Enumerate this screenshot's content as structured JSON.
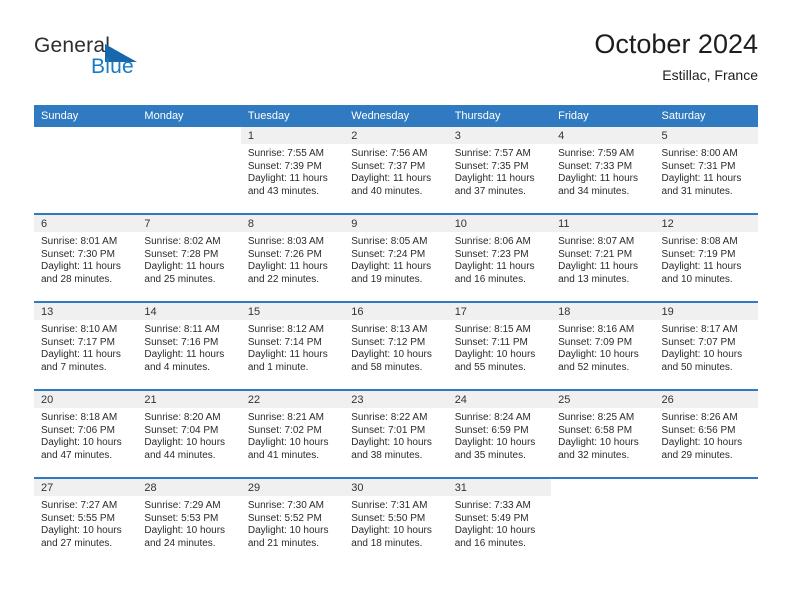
{
  "brand": {
    "name_part1": "General",
    "name_part2": "Blue",
    "triangle_color": "#1668ab",
    "blue_color": "#1a7bc4"
  },
  "header": {
    "title": "October 2024",
    "subtitle": "Estillac, France",
    "accent_color": "#2f7ac0"
  },
  "weekday_headers": [
    "Sunday",
    "Monday",
    "Tuesday",
    "Wednesday",
    "Thursday",
    "Friday",
    "Saturday"
  ],
  "weeks": [
    [
      {
        "day": "",
        "sunrise": "",
        "sunset": "",
        "daylight1": "",
        "daylight2": "",
        "blank": true
      },
      {
        "day": "",
        "sunrise": "",
        "sunset": "",
        "daylight1": "",
        "daylight2": "",
        "blank": true
      },
      {
        "day": "1",
        "sunrise": "Sunrise: 7:55 AM",
        "sunset": "Sunset: 7:39 PM",
        "daylight1": "Daylight: 11 hours",
        "daylight2": "and 43 minutes."
      },
      {
        "day": "2",
        "sunrise": "Sunrise: 7:56 AM",
        "sunset": "Sunset: 7:37 PM",
        "daylight1": "Daylight: 11 hours",
        "daylight2": "and 40 minutes."
      },
      {
        "day": "3",
        "sunrise": "Sunrise: 7:57 AM",
        "sunset": "Sunset: 7:35 PM",
        "daylight1": "Daylight: 11 hours",
        "daylight2": "and 37 minutes."
      },
      {
        "day": "4",
        "sunrise": "Sunrise: 7:59 AM",
        "sunset": "Sunset: 7:33 PM",
        "daylight1": "Daylight: 11 hours",
        "daylight2": "and 34 minutes."
      },
      {
        "day": "5",
        "sunrise": "Sunrise: 8:00 AM",
        "sunset": "Sunset: 7:31 PM",
        "daylight1": "Daylight: 11 hours",
        "daylight2": "and 31 minutes."
      }
    ],
    [
      {
        "day": "6",
        "sunrise": "Sunrise: 8:01 AM",
        "sunset": "Sunset: 7:30 PM",
        "daylight1": "Daylight: 11 hours",
        "daylight2": "and 28 minutes."
      },
      {
        "day": "7",
        "sunrise": "Sunrise: 8:02 AM",
        "sunset": "Sunset: 7:28 PM",
        "daylight1": "Daylight: 11 hours",
        "daylight2": "and 25 minutes."
      },
      {
        "day": "8",
        "sunrise": "Sunrise: 8:03 AM",
        "sunset": "Sunset: 7:26 PM",
        "daylight1": "Daylight: 11 hours",
        "daylight2": "and 22 minutes."
      },
      {
        "day": "9",
        "sunrise": "Sunrise: 8:05 AM",
        "sunset": "Sunset: 7:24 PM",
        "daylight1": "Daylight: 11 hours",
        "daylight2": "and 19 minutes."
      },
      {
        "day": "10",
        "sunrise": "Sunrise: 8:06 AM",
        "sunset": "Sunset: 7:23 PM",
        "daylight1": "Daylight: 11 hours",
        "daylight2": "and 16 minutes."
      },
      {
        "day": "11",
        "sunrise": "Sunrise: 8:07 AM",
        "sunset": "Sunset: 7:21 PM",
        "daylight1": "Daylight: 11 hours",
        "daylight2": "and 13 minutes."
      },
      {
        "day": "12",
        "sunrise": "Sunrise: 8:08 AM",
        "sunset": "Sunset: 7:19 PM",
        "daylight1": "Daylight: 11 hours",
        "daylight2": "and 10 minutes."
      }
    ],
    [
      {
        "day": "13",
        "sunrise": "Sunrise: 8:10 AM",
        "sunset": "Sunset: 7:17 PM",
        "daylight1": "Daylight: 11 hours",
        "daylight2": "and 7 minutes."
      },
      {
        "day": "14",
        "sunrise": "Sunrise: 8:11 AM",
        "sunset": "Sunset: 7:16 PM",
        "daylight1": "Daylight: 11 hours",
        "daylight2": "and 4 minutes."
      },
      {
        "day": "15",
        "sunrise": "Sunrise: 8:12 AM",
        "sunset": "Sunset: 7:14 PM",
        "daylight1": "Daylight: 11 hours",
        "daylight2": "and 1 minute."
      },
      {
        "day": "16",
        "sunrise": "Sunrise: 8:13 AM",
        "sunset": "Sunset: 7:12 PM",
        "daylight1": "Daylight: 10 hours",
        "daylight2": "and 58 minutes."
      },
      {
        "day": "17",
        "sunrise": "Sunrise: 8:15 AM",
        "sunset": "Sunset: 7:11 PM",
        "daylight1": "Daylight: 10 hours",
        "daylight2": "and 55 minutes."
      },
      {
        "day": "18",
        "sunrise": "Sunrise: 8:16 AM",
        "sunset": "Sunset: 7:09 PM",
        "daylight1": "Daylight: 10 hours",
        "daylight2": "and 52 minutes."
      },
      {
        "day": "19",
        "sunrise": "Sunrise: 8:17 AM",
        "sunset": "Sunset: 7:07 PM",
        "daylight1": "Daylight: 10 hours",
        "daylight2": "and 50 minutes."
      }
    ],
    [
      {
        "day": "20",
        "sunrise": "Sunrise: 8:18 AM",
        "sunset": "Sunset: 7:06 PM",
        "daylight1": "Daylight: 10 hours",
        "daylight2": "and 47 minutes."
      },
      {
        "day": "21",
        "sunrise": "Sunrise: 8:20 AM",
        "sunset": "Sunset: 7:04 PM",
        "daylight1": "Daylight: 10 hours",
        "daylight2": "and 44 minutes."
      },
      {
        "day": "22",
        "sunrise": "Sunrise: 8:21 AM",
        "sunset": "Sunset: 7:02 PM",
        "daylight1": "Daylight: 10 hours",
        "daylight2": "and 41 minutes."
      },
      {
        "day": "23",
        "sunrise": "Sunrise: 8:22 AM",
        "sunset": "Sunset: 7:01 PM",
        "daylight1": "Daylight: 10 hours",
        "daylight2": "and 38 minutes."
      },
      {
        "day": "24",
        "sunrise": "Sunrise: 8:24 AM",
        "sunset": "Sunset: 6:59 PM",
        "daylight1": "Daylight: 10 hours",
        "daylight2": "and 35 minutes."
      },
      {
        "day": "25",
        "sunrise": "Sunrise: 8:25 AM",
        "sunset": "Sunset: 6:58 PM",
        "daylight1": "Daylight: 10 hours",
        "daylight2": "and 32 minutes."
      },
      {
        "day": "26",
        "sunrise": "Sunrise: 8:26 AM",
        "sunset": "Sunset: 6:56 PM",
        "daylight1": "Daylight: 10 hours",
        "daylight2": "and 29 minutes."
      }
    ],
    [
      {
        "day": "27",
        "sunrise": "Sunrise: 7:27 AM",
        "sunset": "Sunset: 5:55 PM",
        "daylight1": "Daylight: 10 hours",
        "daylight2": "and 27 minutes."
      },
      {
        "day": "28",
        "sunrise": "Sunrise: 7:29 AM",
        "sunset": "Sunset: 5:53 PM",
        "daylight1": "Daylight: 10 hours",
        "daylight2": "and 24 minutes."
      },
      {
        "day": "29",
        "sunrise": "Sunrise: 7:30 AM",
        "sunset": "Sunset: 5:52 PM",
        "daylight1": "Daylight: 10 hours",
        "daylight2": "and 21 minutes."
      },
      {
        "day": "30",
        "sunrise": "Sunrise: 7:31 AM",
        "sunset": "Sunset: 5:50 PM",
        "daylight1": "Daylight: 10 hours",
        "daylight2": "and 18 minutes."
      },
      {
        "day": "31",
        "sunrise": "Sunrise: 7:33 AM",
        "sunset": "Sunset: 5:49 PM",
        "daylight1": "Daylight: 10 hours",
        "daylight2": "and 16 minutes."
      },
      {
        "day": "",
        "sunrise": "",
        "sunset": "",
        "daylight1": "",
        "daylight2": "",
        "blank": true
      },
      {
        "day": "",
        "sunrise": "",
        "sunset": "",
        "daylight1": "",
        "daylight2": "",
        "blank": true
      }
    ]
  ]
}
